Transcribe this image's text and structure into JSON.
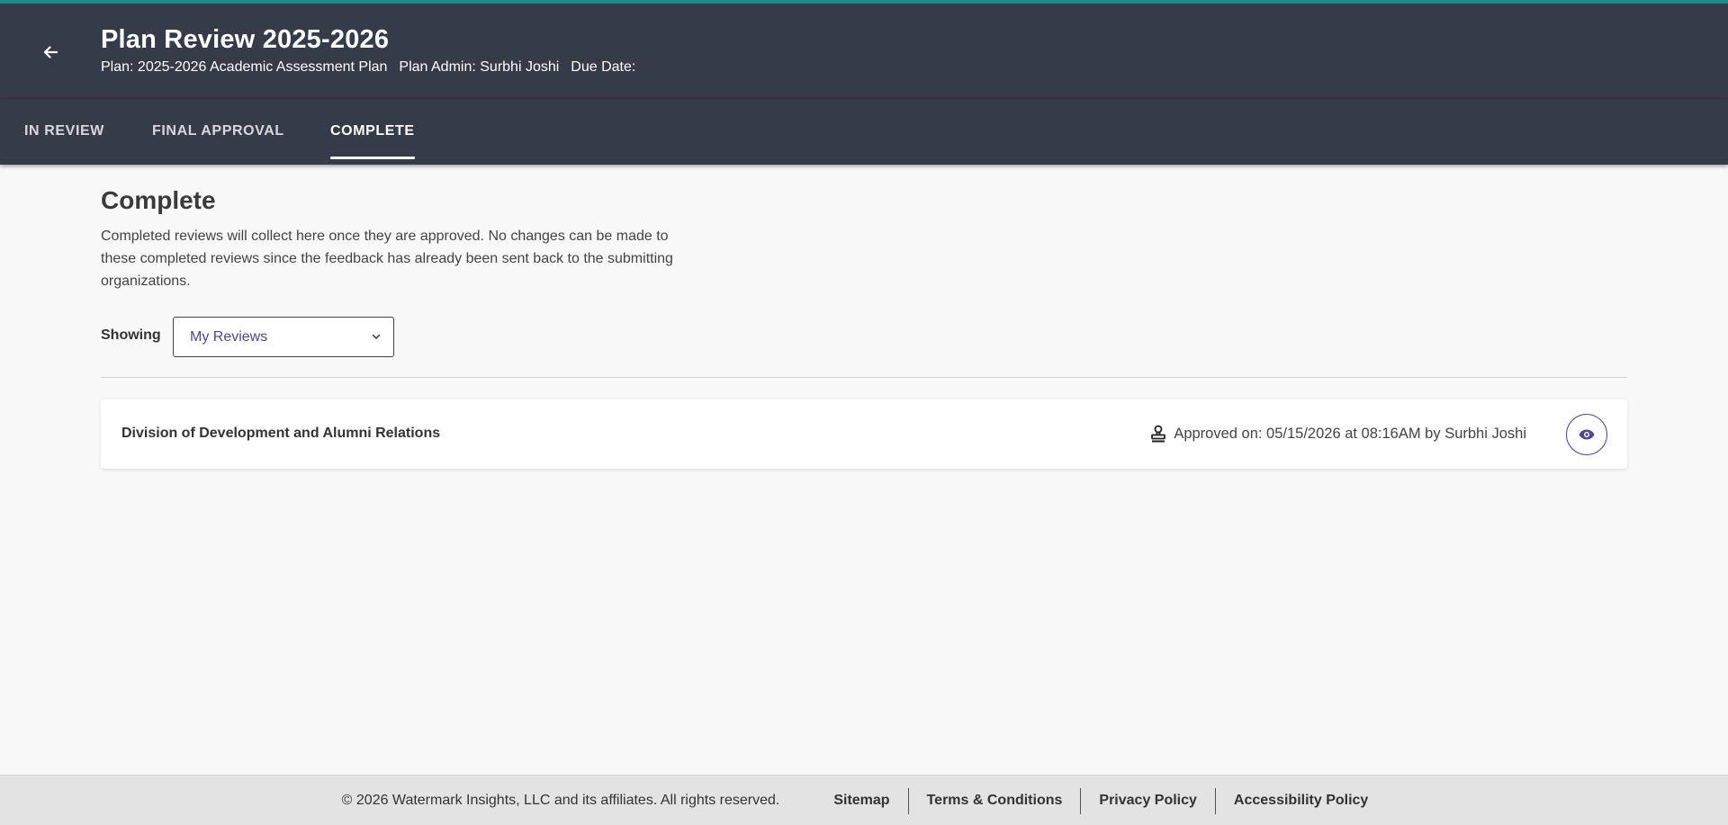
{
  "header": {
    "title": "Plan Review 2025-2026",
    "plan": "Plan: 2025-2026 Academic Assessment Plan",
    "plan_admin": "Plan Admin: Surbhi Joshi",
    "due_date": "Due Date:",
    "back_icon": "arrow-left-icon"
  },
  "tabs": [
    {
      "label": "IN REVIEW",
      "active": false
    },
    {
      "label": "FINAL APPROVAL",
      "active": false
    },
    {
      "label": "COMPLETE",
      "active": true
    }
  ],
  "section": {
    "title": "Complete",
    "description": "Completed reviews will collect here once they are approved. No changes can be made to these completed reviews since the feedback has already been sent back to the submitting organizations."
  },
  "filter": {
    "label": "Showing",
    "selected": "My Reviews"
  },
  "reviews": [
    {
      "organization": "Division of Development and Alumni Relations",
      "approved_text": "Approved on: 05/15/2026 at 08:16AM by Surbhi Joshi",
      "status_icon": "stamp-icon",
      "action_icon": "eye-icon"
    }
  ],
  "footer": {
    "copyright": "© 2026 Watermark Insights, LLC and its affiliates. All rights reserved.",
    "links": [
      "Sitemap",
      "Terms & Conditions",
      "Privacy Policy",
      "Accessibility Policy"
    ]
  },
  "colors": {
    "header_bg": "#363b4a",
    "accent": "#1a8a8a",
    "select_text": "#4e4a86"
  }
}
